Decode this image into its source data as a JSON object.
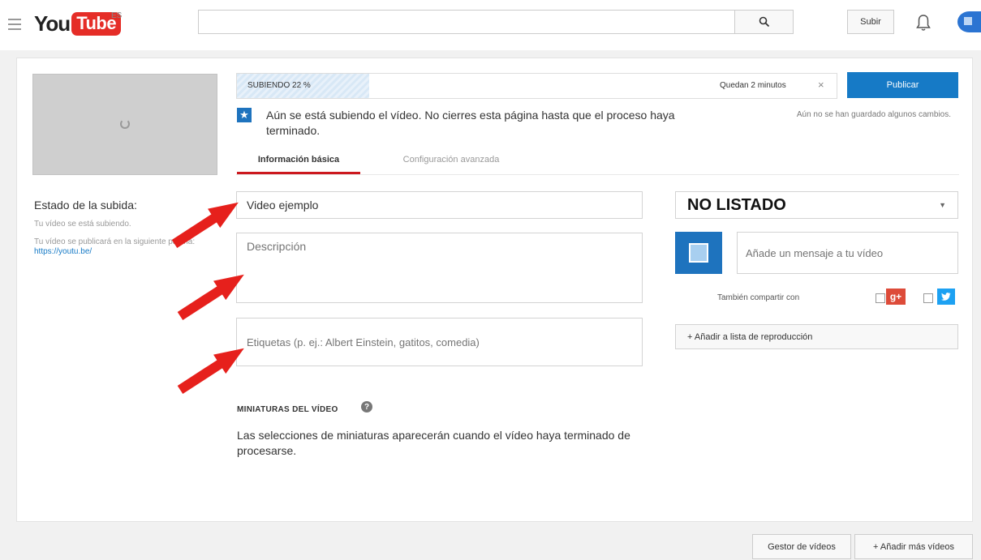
{
  "header": {
    "logo_you": "You",
    "logo_tube": "Tube",
    "region": "ES",
    "search_placeholder": "",
    "upload_label": "Subir"
  },
  "upload": {
    "progress_label": "SUBIENDO 22 %",
    "progress_percent": 22,
    "remaining": "Quedan 2 minutos",
    "cancel_glyph": "×",
    "publish_label": "Publicar",
    "warning": "Aún se está subiendo el vídeo. No cierres esta página hasta que el proceso haya terminado.",
    "unsaved_notice": "Aún no se han guardado algunos cambios."
  },
  "tabs": [
    {
      "label": "Información básica",
      "active": true
    },
    {
      "label": "Configuración avanzada",
      "active": false
    }
  ],
  "status": {
    "title": "Estado de la subida:",
    "line1": "Tu vídeo se está subiendo.",
    "line2": "Tu vídeo se publicará en la siguiente página: ",
    "link": "https://youtu.be/"
  },
  "form": {
    "title_value": "Video ejemplo",
    "description_placeholder": "Descripción",
    "tags_placeholder": "Etiquetas (p. ej.: Albert Einstein, gatitos, comedia)",
    "privacy_value": "NO LISTADO",
    "share_placeholder": "Añade un mensaje a tu vídeo",
    "share_with_label": "También compartir con",
    "playlist_label": "+ Añadir a lista de reproducción"
  },
  "thumbnails": {
    "heading": "MINIATURAS DEL VÍDEO",
    "note": "Las selecciones de miniaturas aparecerán cuando el vídeo haya terminado de procesarse."
  },
  "footer": {
    "manager_label": "Gestor de vídeos",
    "add_more_label": "+ Añadir más vídeos"
  },
  "icons": {
    "menu": "menu-icon",
    "search": "search-icon",
    "bell": "bell-icon",
    "star": "star-icon",
    "help": "help-icon",
    "gplus": "google-plus-icon",
    "twitter": "twitter-icon"
  },
  "colors": {
    "brand_red": "#e52d27",
    "accent_blue": "#167ac6",
    "arrow_red": "#e6201c",
    "tab_underline": "#cc181e"
  }
}
